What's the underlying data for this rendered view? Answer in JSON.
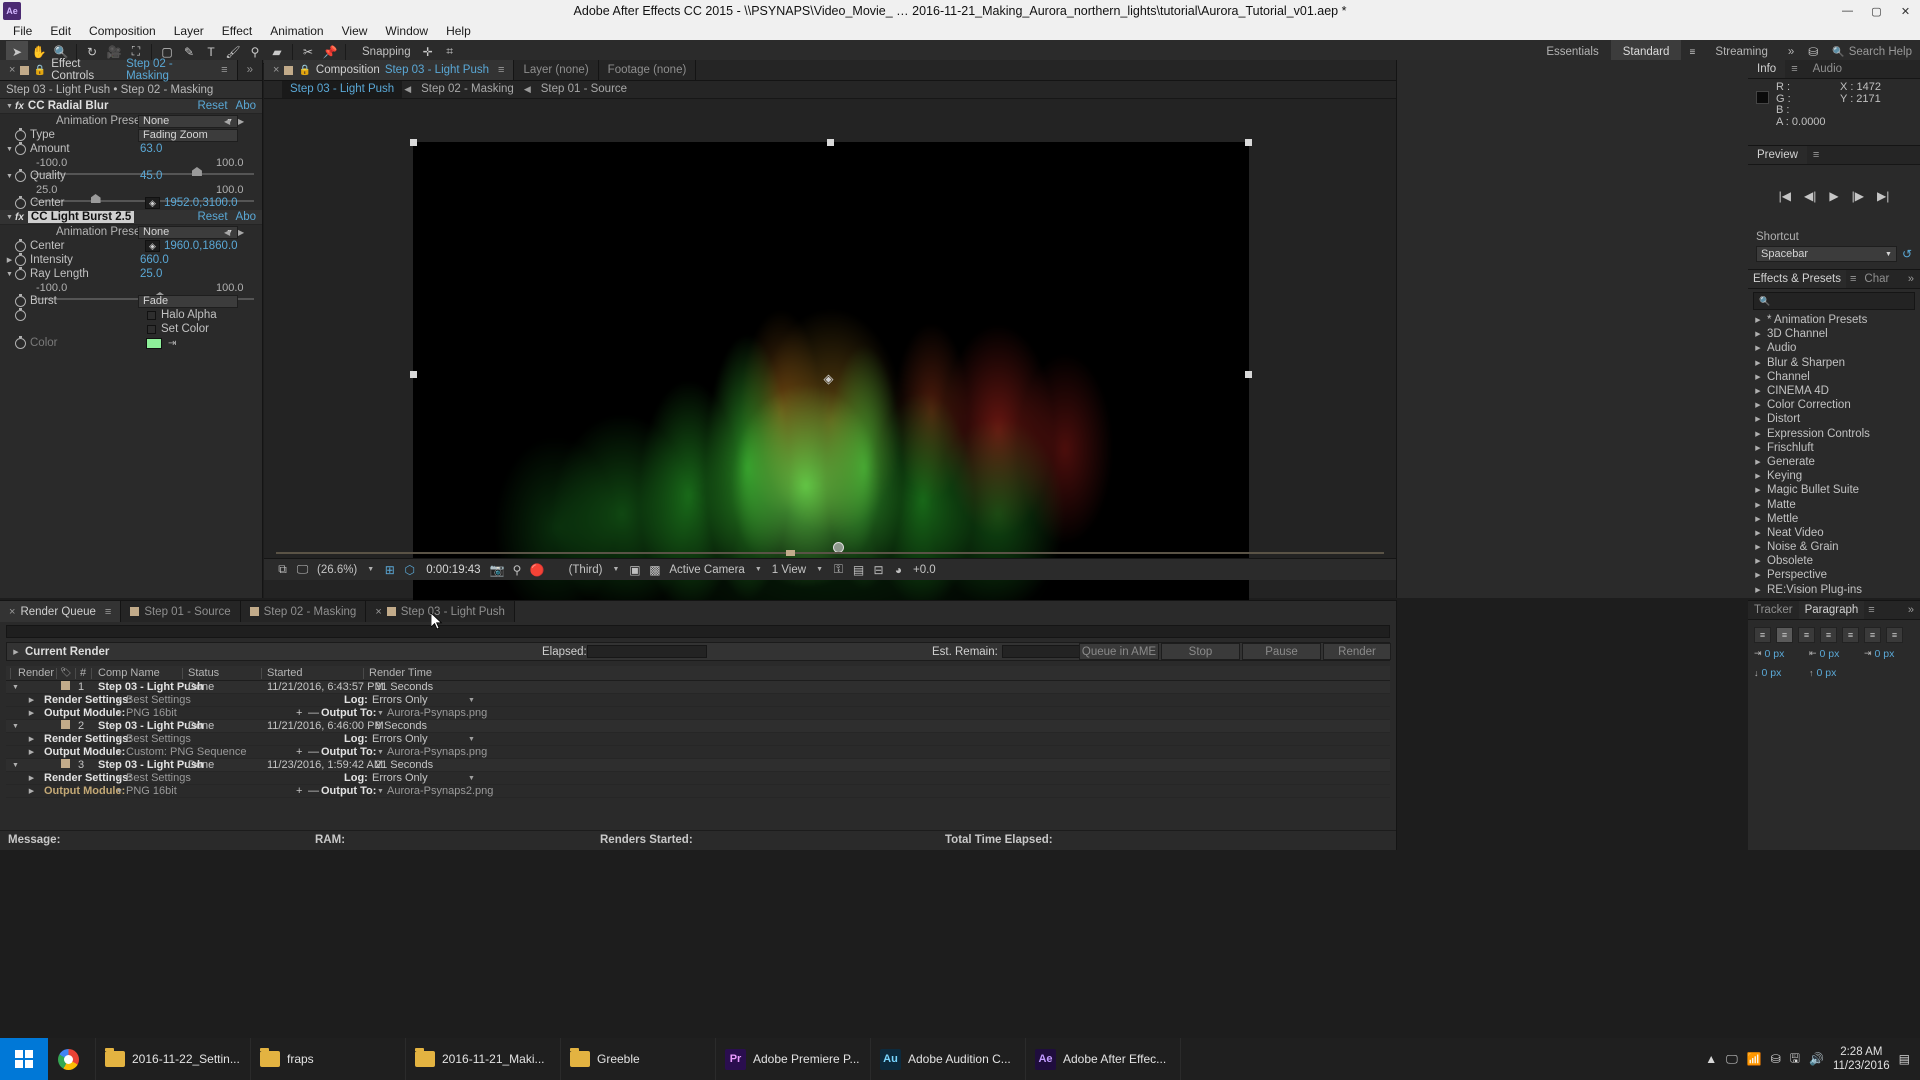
{
  "window": {
    "app_badge": "Ae",
    "title": "Adobe After Effects CC 2015 - \\\\PSYNAPS\\Video_Movie_ … 2016-11-21_Making_Aurora_northern_lights\\tutorial\\Aurora_Tutorial_v01.aep *",
    "minimize": "—",
    "maximize": "▢",
    "close": "✕"
  },
  "menubar": {
    "items": [
      "File",
      "Edit",
      "Composition",
      "Layer",
      "Effect",
      "Animation",
      "View",
      "Window",
      "Help"
    ]
  },
  "toolbar": {
    "tools": [
      {
        "name": "selection-tool",
        "glyph": "➤"
      },
      {
        "name": "hand-tool",
        "glyph": "✋"
      },
      {
        "name": "zoom-tool",
        "glyph": "🔍"
      },
      {
        "name": "rotation-tool",
        "glyph": "↻"
      },
      {
        "name": "camera-tool",
        "glyph": "🎥"
      },
      {
        "name": "pan-behind-tool",
        "glyph": "⛶"
      },
      {
        "name": "shape-tool",
        "glyph": "▢"
      },
      {
        "name": "pen-tool",
        "glyph": "✎"
      },
      {
        "name": "type-tool",
        "glyph": "T"
      },
      {
        "name": "brush-tool",
        "glyph": "🖌"
      },
      {
        "name": "clone-stamp-tool",
        "glyph": "⚲"
      },
      {
        "name": "eraser-tool",
        "glyph": "▰"
      },
      {
        "name": "roto-brush-tool",
        "glyph": "✂"
      },
      {
        "name": "puppet-pin-tool",
        "glyph": "📌"
      }
    ],
    "snapping_label": "Snapping",
    "snap_icons": [
      "✛",
      "⌗"
    ],
    "axis_tools": [
      {
        "name": "local-axis-mode",
        "glyph": "⟂"
      },
      {
        "name": "world-axis-mode",
        "glyph": "⊥"
      },
      {
        "name": "view-axis-mode",
        "glyph": "⟊"
      }
    ],
    "workspaces": [
      "Essentials",
      "Standard",
      "Streaming"
    ],
    "workspace_active": "Standard",
    "workspace_more": "»",
    "sync_icon": "⛁",
    "search_icon": "🔍",
    "search_placeholder": "Search Help"
  },
  "effect_controls": {
    "tab_close": "×",
    "tab_label": "Effect Controls",
    "tab_comp": "Step 02 - Masking",
    "tab_menu": "≡",
    "tab_more": "»",
    "header": "Step 03 - Light Push • Step 02 - Masking",
    "effects": [
      {
        "name": "CC Radial Blur",
        "selected": false,
        "reset": "Reset",
        "about": "Abo",
        "presets_label": "Animation Presets:",
        "presets_value": "None",
        "params": [
          {
            "kind": "dropdown",
            "label": "Type",
            "value": "Fading Zoom"
          },
          {
            "kind": "slider",
            "label": "Amount",
            "value": "63.0",
            "min": "-100.0",
            "max": "100.0",
            "pct": 81
          },
          {
            "kind": "slider",
            "label": "Quality",
            "value": "45.0",
            "min": "25.0",
            "max": "100.0",
            "pct": 29
          },
          {
            "kind": "point",
            "label": "Center",
            "value": "1952.0,3100.0"
          }
        ]
      },
      {
        "name": "CC Light Burst 2.5",
        "selected": true,
        "reset": "Reset",
        "about": "Abo",
        "presets_label": "Animation Presets:",
        "presets_value": "None",
        "params": [
          {
            "kind": "point",
            "label": "Center",
            "value": "1960.0,1860.0"
          },
          {
            "kind": "value",
            "label": "Intensity",
            "value": "660.0"
          },
          {
            "kind": "slider",
            "label": "Ray Length",
            "value": "25.0",
            "min": "-100.0",
            "max": "100.0",
            "pct": 62
          },
          {
            "kind": "dropdown",
            "label": "Burst",
            "value": "Fade"
          },
          {
            "kind": "checkbox",
            "label": "Halo Alpha"
          },
          {
            "kind": "checkbox2",
            "label": "Set Color"
          },
          {
            "kind": "color",
            "label": "Color",
            "swatch": "#8ef09a"
          }
        ]
      }
    ]
  },
  "composition": {
    "tabs": [
      {
        "label": "Composition",
        "value": "Step 03 - Light Push",
        "active": true,
        "close": "×",
        "menu": "≡"
      },
      {
        "label": "Layer (none)",
        "active": false
      },
      {
        "label": "Footage (none)",
        "active": false
      }
    ],
    "breadcrumbs": [
      {
        "label": "Step 03 - Light Push",
        "active": true
      },
      {
        "label": "Step 02 - Masking",
        "active": false
      },
      {
        "label": "Step 01 - Source",
        "active": false
      }
    ],
    "crumb_arrow": "◀",
    "toolbar": {
      "main_icons": [
        "⧉",
        "🖵"
      ],
      "zoom": "(26.6%)",
      "zoom_caret": "▼",
      "grid_icon": "⊞",
      "mask_icon": "⬡",
      "timecode": "0:00:19:43",
      "snapshot_icon": "📷",
      "show_snapshot_icon": "⚲",
      "channel_icon": "🔴",
      "resolution": "(Third)",
      "resolution_caret": "▼",
      "region_icon": "▣",
      "transparency_icon": "▩",
      "camera": "Active Camera",
      "camera_caret": "▼",
      "views": "1 View",
      "views_caret": "▼",
      "lock_icon": "⚿",
      "pixel_icon": "▤",
      "timeline_icon": "⊟",
      "color_icon": "◕",
      "exposure": "+0.0"
    }
  },
  "info_panel": {
    "tabs": [
      "Info",
      "Audio"
    ],
    "active_tab": "Info",
    "menu": "≡",
    "rgba": [
      "R :",
      "G :",
      "B :",
      "A : 0.0000"
    ],
    "coords": [
      "X : 1472",
      "Y : 2171"
    ]
  },
  "preview_panel": {
    "title": "Preview",
    "menu": "≡",
    "buttons": [
      {
        "name": "first-frame-button",
        "glyph": "|◀"
      },
      {
        "name": "previous-frame-button",
        "glyph": "◀|"
      },
      {
        "name": "play-button",
        "glyph": "▶"
      },
      {
        "name": "next-frame-button",
        "glyph": "|▶"
      },
      {
        "name": "last-frame-button",
        "glyph": "▶|"
      }
    ],
    "shortcut_label": "Shortcut",
    "shortcut_value": "Spacebar",
    "reload_icon": "↺"
  },
  "effects_presets": {
    "tabs": [
      "Effects & Presets",
      "Char"
    ],
    "active_tab": "Effects & Presets",
    "menu": "≡",
    "more": "»",
    "search_icon": "🔍",
    "search_value": "",
    "categories": [
      "* Animation Presets",
      "3D Channel",
      "Audio",
      "Blur & Sharpen",
      "Channel",
      "CINEMA 4D",
      "Color Correction",
      "Distort",
      "Expression Controls",
      "Frischluft",
      "Generate",
      "Keying",
      "Magic Bullet Suite",
      "Matte",
      "Mettle",
      "Neat Video",
      "Noise & Grain",
      "Obsolete",
      "Perspective",
      "RE:Vision Plug-ins"
    ]
  },
  "render_queue": {
    "tabs": [
      {
        "label": "Render Queue",
        "active": true,
        "menu": "≡"
      },
      {
        "label": "Step 01 - Source",
        "active": false
      },
      {
        "label": "Step 02 - Masking",
        "active": false
      },
      {
        "label": "Step 03 - Light Push",
        "active": false,
        "close": "×"
      }
    ],
    "current_render_label": "Current Render",
    "current_render_tri": "▶",
    "elapsed_label": "Elapsed:",
    "est_remain_label": "Est. Remain:",
    "buttons": [
      "Queue in AME",
      "Stop",
      "Pause",
      "Render"
    ],
    "columns": [
      "Render",
      "#",
      "Comp Name",
      "Status",
      "Started",
      "Render Time"
    ],
    "tag_icon": "🏷",
    "items": [
      {
        "index": "1",
        "comp_name": "Step 03 - Light Push",
        "status": "Done",
        "started": "11/21/2016, 6:43:57 PM",
        "render_time": "31 Seconds",
        "render_settings_label": "Render Settings:",
        "render_settings_value": "Best Settings",
        "log_label": "Log:",
        "log_value": "Errors Only",
        "output_module_label": "Output Module:",
        "output_module_value": "PNG 16bit",
        "output_to_label": "Output To:",
        "output_to_value": "Aurora-Psynaps.png",
        "plus": "+",
        "minus": "—"
      },
      {
        "index": "2",
        "comp_name": "Step 03 - Light Push",
        "status": "Done",
        "started": "11/21/2016, 6:46:00 PM",
        "render_time": "8 Seconds",
        "render_settings_label": "Render Settings:",
        "render_settings_value": "Best Settings",
        "log_label": "Log:",
        "log_value": "Errors Only",
        "output_module_label": "Output Module:",
        "output_module_value": "Custom: PNG Sequence",
        "output_to_label": "Output To:",
        "output_to_value": "Aurora-Psynaps.png",
        "plus": "+",
        "minus": "—"
      },
      {
        "index": "3",
        "comp_name": "Step 03 - Light Push",
        "status": "Done",
        "started": "11/23/2016, 1:59:42 AM",
        "render_time": "21 Seconds",
        "render_settings_label": "Render Settings:",
        "render_settings_value": "Best Settings",
        "log_label": "Log:",
        "log_value": "Errors Only",
        "output_module_label": "Output Module:",
        "output_module_value": "PNG 16bit",
        "output_to_label": "Output To:",
        "output_to_value": "Aurora-Psynaps2.png",
        "plus": "+",
        "minus": "—"
      }
    ],
    "status_bar": {
      "message_label": "Message:",
      "ram_label": "RAM:",
      "renders_started_label": "Renders Started:",
      "total_time_label": "Total Time Elapsed:"
    }
  },
  "tracker_paragraph": {
    "tabs": [
      "Tracker",
      "Paragraph"
    ],
    "active_tab": "Paragraph",
    "menu": "≡",
    "more": "»",
    "align_buttons": [
      "≡",
      "≡",
      "≡",
      "≡",
      "≡",
      "≡",
      "≡"
    ],
    "indent_fields": [
      {
        "icon": "⇥",
        "value": "0 px"
      },
      {
        "icon": "⇤",
        "value": "0 px"
      },
      {
        "icon": "⇥",
        "value": "0 px"
      },
      {
        "icon": "↓",
        "value": "0 px"
      },
      {
        "icon": "↑",
        "value": "0 px"
      }
    ]
  },
  "taskbar": {
    "start_label": "Start",
    "items": [
      {
        "name": "chrome",
        "label": "",
        "kind": "chrome"
      },
      {
        "name": "folder-settings",
        "label": "2016-11-22_Settin...",
        "kind": "folder"
      },
      {
        "name": "folder-fraps",
        "label": "fraps",
        "kind": "folder"
      },
      {
        "name": "folder-making",
        "label": "2016-11-21_Maki...",
        "kind": "folder"
      },
      {
        "name": "folder-greeble",
        "label": "Greeble",
        "kind": "folder"
      },
      {
        "name": "premiere",
        "label": "Adobe Premiere P...",
        "kind": "adobe",
        "badge": "Pr",
        "color": "#2a0e4f",
        "text": "#ea9bff"
      },
      {
        "name": "audition",
        "label": "Adobe Audition C...",
        "kind": "adobe",
        "badge": "Au",
        "color": "#0d2a3d",
        "text": "#7ad6ff"
      },
      {
        "name": "after-effects",
        "label": "Adobe After Effec...",
        "kind": "adobe",
        "badge": "Ae",
        "color": "#1f0d3d",
        "text": "#c29bff"
      }
    ],
    "tray": {
      "expand": "▲",
      "icons": [
        "🖵",
        "📶",
        "⛁",
        "🖫",
        "🔊"
      ],
      "time": "2:28 AM",
      "date": "11/23/2016",
      "notification": "▤"
    }
  }
}
